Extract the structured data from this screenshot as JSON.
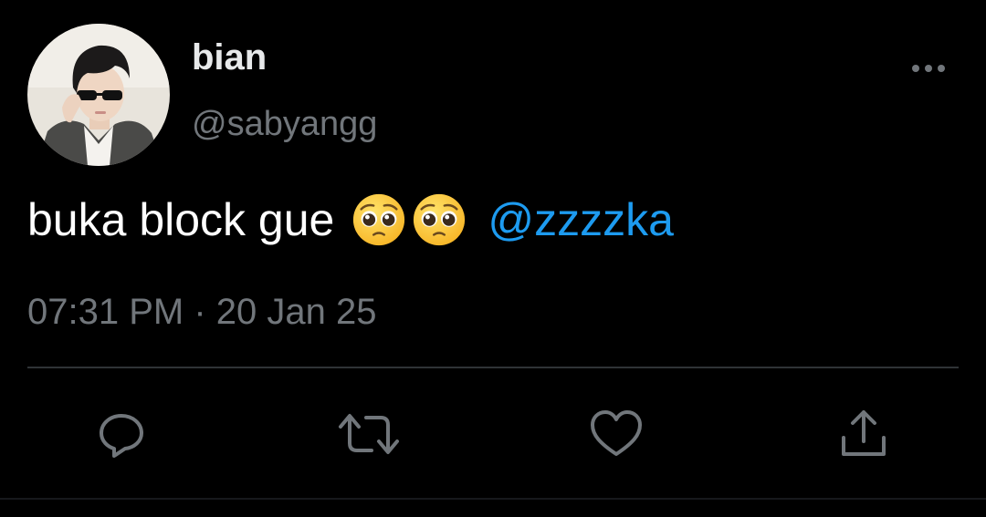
{
  "tweet": {
    "display_name": "bian",
    "handle": "@sabyangg",
    "text": "buka block gue",
    "mention": "@zzzzka",
    "timestamp": "07:31 PM · 20 Jan 25"
  },
  "icons": {
    "more": "more-horizontal-icon",
    "reply": "reply-icon",
    "retweet": "retweet-icon",
    "like": "heart-icon",
    "share": "share-icon",
    "emoji": "pleading-face-emoji"
  },
  "colors": {
    "background": "#000000",
    "text": "#ffffff",
    "secondary": "#71767b",
    "link": "#1d9bf0",
    "divider": "#2f3336"
  }
}
